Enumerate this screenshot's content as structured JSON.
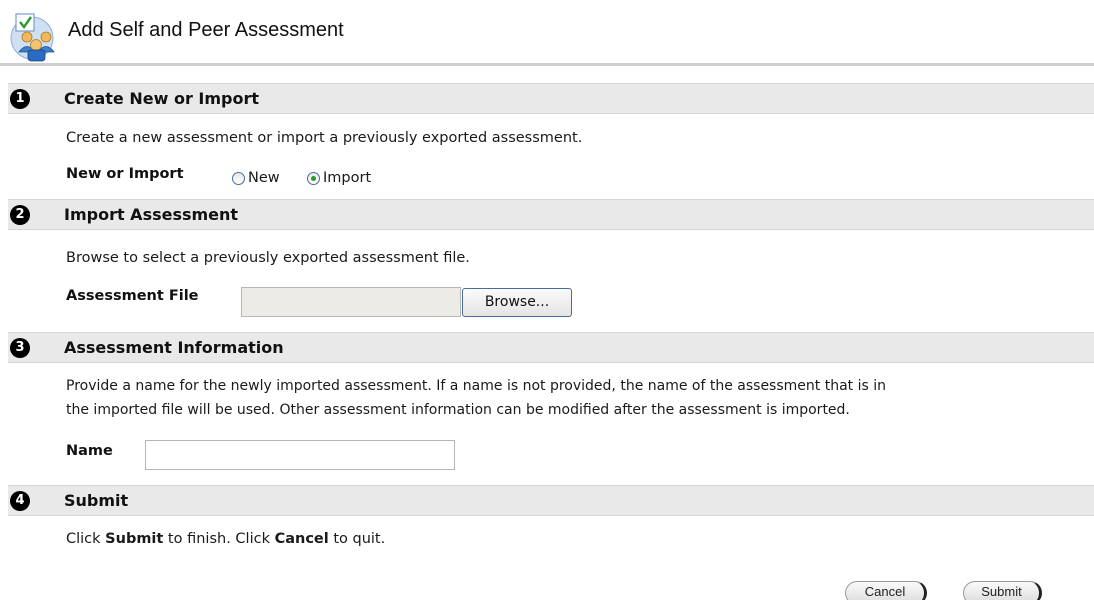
{
  "header": {
    "title": "Add Self and Peer Assessment",
    "icon": "self-peer-assessment-icon"
  },
  "steps": [
    {
      "number": "1",
      "title": "Create New or Import",
      "instructions": "Create a new assessment or import a previously exported assessment.",
      "field_label": "New or Import",
      "options": [
        {
          "label": "New",
          "checked": false
        },
        {
          "label": "Import",
          "checked": true
        }
      ]
    },
    {
      "number": "2",
      "title": "Import Assessment",
      "instructions": "Browse to select a previously exported assessment file.",
      "field_label": "Assessment File",
      "file_value": "",
      "browse_label": "Browse..."
    },
    {
      "number": "3",
      "title": "Assessment Information",
      "instructions_line1": "Provide a name for the newly imported assessment. If a name is not provided, the name of the assessment that is in",
      "instructions_line2": "the imported file will be used. Other assessment information can be modified after the assessment is imported.",
      "field_label": "Name",
      "name_value": ""
    },
    {
      "number": "4",
      "title": "Submit",
      "instr_part1": "Click ",
      "instr_submit": "Submit",
      "instr_part2": " to finish. Click ",
      "instr_cancel": "Cancel",
      "instr_part3": " to quit."
    }
  ],
  "actions": {
    "cancel_label": "Cancel",
    "submit_label": "Submit"
  },
  "colors": {
    "step_bar_bg": "#e9e9e9",
    "radio_checked": "#2a9a2a",
    "file_field_bg": "#ecebe6"
  }
}
